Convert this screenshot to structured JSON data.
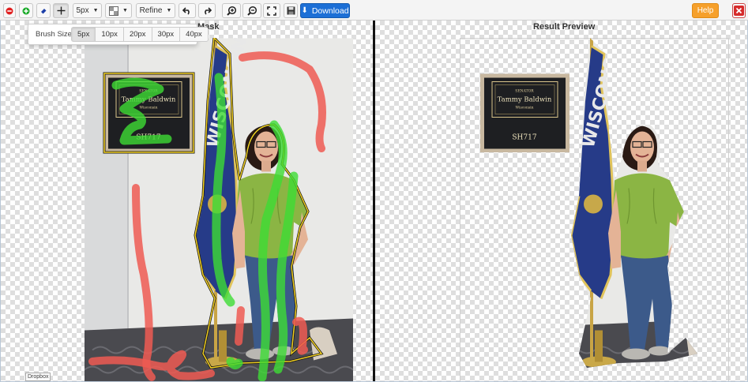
{
  "toolbar": {
    "brush_size": "5px",
    "refine_label": "Refine",
    "download_label": "Download",
    "help_label": "Help"
  },
  "brush_popover": {
    "label": "Brush Size:",
    "options": [
      "5px",
      "10px",
      "20px",
      "30px",
      "40px"
    ],
    "selected": "5px"
  },
  "panes": {
    "left_title": "Mask",
    "right_title": "Result Preview"
  },
  "photo": {
    "placard_line1": "SENATOR",
    "placard_name": "Tammy Baldwin",
    "placard_state": "Wisconsin",
    "placard_room": "SH717"
  },
  "footer": {
    "dropbox_label": "Dropbox"
  },
  "colors": {
    "foreground_marker": "#3ddc34",
    "background_marker": "#ee5a52",
    "download": "#1c6fd6",
    "help": "#f6a02b"
  }
}
